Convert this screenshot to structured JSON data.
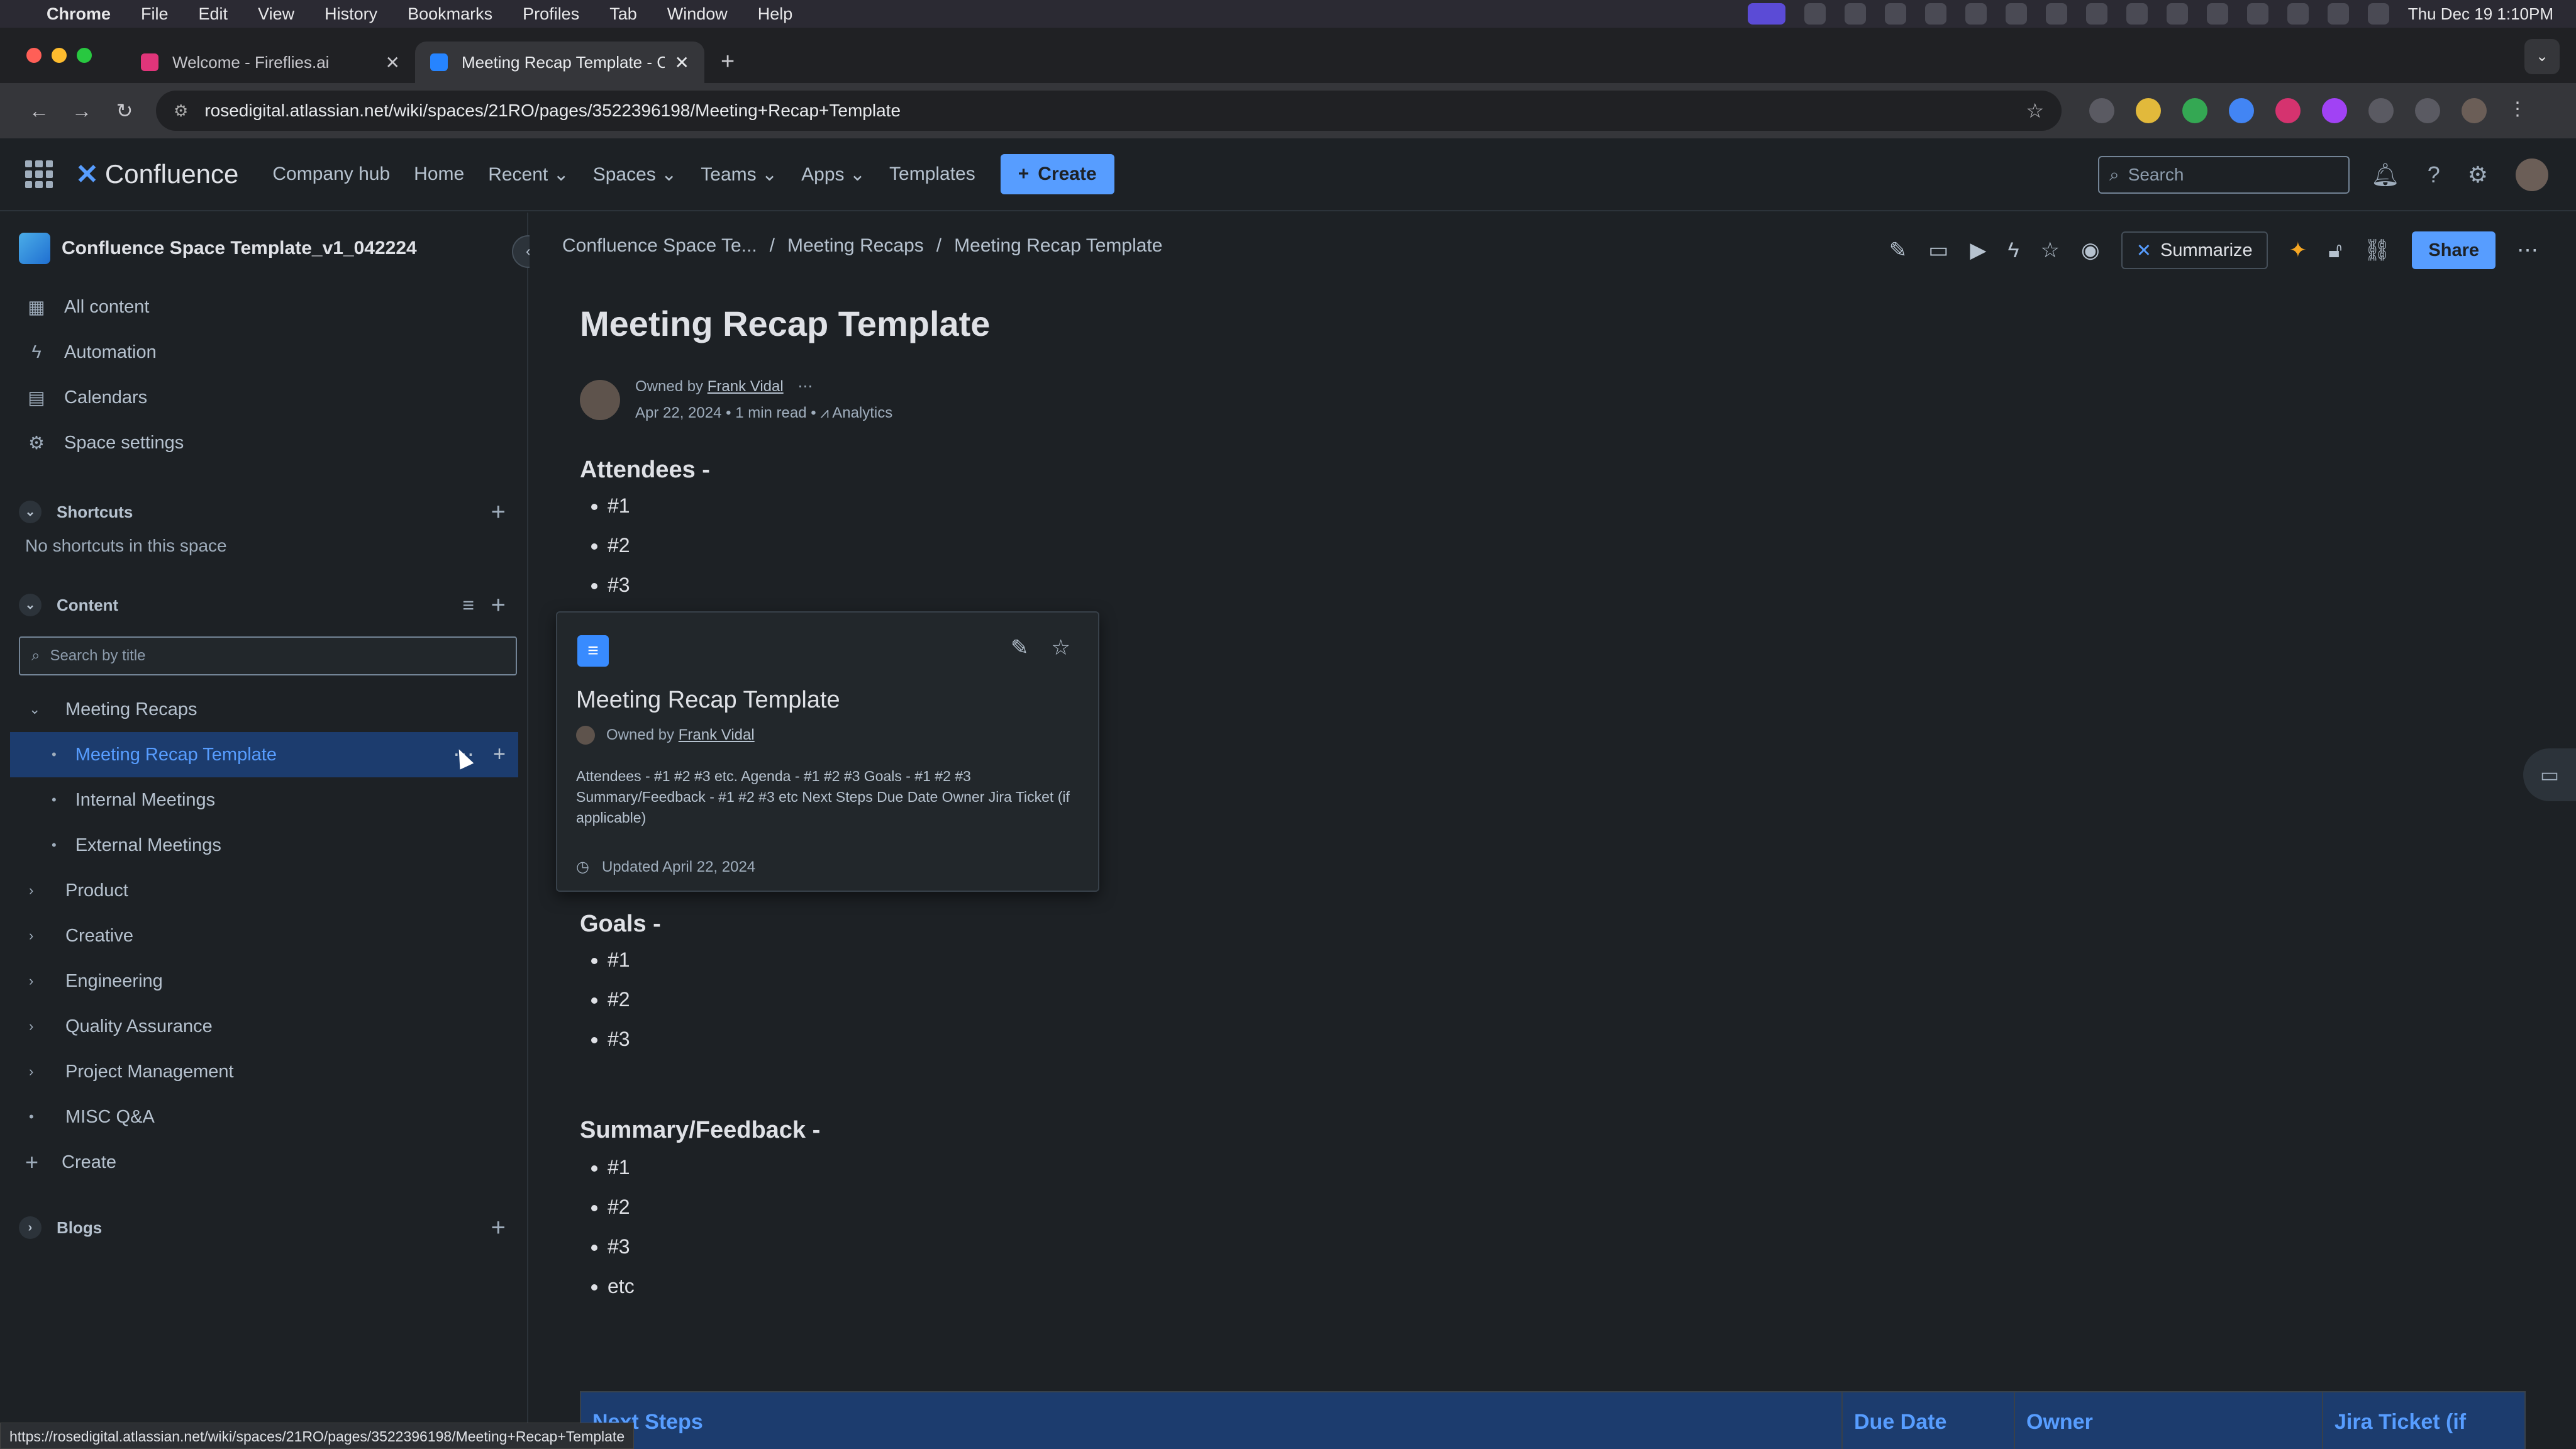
{
  "os_menubar": {
    "app": "Chrome",
    "items": [
      "File",
      "Edit",
      "View",
      "History",
      "Bookmarks",
      "Profiles",
      "Tab",
      "Window",
      "Help"
    ],
    "clock": "Thu Dec 19  1:10PM"
  },
  "browser": {
    "tabs": [
      {
        "label": "Welcome - Fireflies.ai",
        "active": false
      },
      {
        "label": "Meeting Recap Template - Co",
        "active": true
      }
    ],
    "url": "rosedigital.atlassian.net/wiki/spaces/21RO/pages/3522396198/Meeting+Recap+Template",
    "status_url": "https://rosedigital.atlassian.net/wiki/spaces/21RO/pages/3522396198/Meeting+Recap+Template"
  },
  "header": {
    "logo": "Confluence",
    "nav": [
      "Company hub",
      "Home",
      "Recent",
      "Spaces",
      "Teams",
      "Apps",
      "Templates"
    ],
    "create_label": "Create",
    "search_placeholder": "Search"
  },
  "sidebar": {
    "space_name": "Confluence Space Template_v1_042224",
    "nav": [
      {
        "icon": "grid-icon",
        "label": "All content"
      },
      {
        "icon": "bolt-icon",
        "label": "Automation"
      },
      {
        "icon": "calendar-icon",
        "label": "Calendars"
      },
      {
        "icon": "gear-icon",
        "label": "Space settings"
      }
    ],
    "shortcuts_title": "Shortcuts",
    "shortcuts_empty": "No shortcuts in this space",
    "content_title": "Content",
    "search_placeholder": "Search by title",
    "tree": [
      {
        "label": "Meeting Recaps",
        "level": 0,
        "expanded": true
      },
      {
        "label": "Meeting Recap Template",
        "level": 1,
        "active": true
      },
      {
        "label": "Internal Meetings",
        "level": 1
      },
      {
        "label": "External Meetings",
        "level": 1
      },
      {
        "label": "Product",
        "level": 0
      },
      {
        "label": "Creative",
        "level": 0
      },
      {
        "label": "Engineering",
        "level": 0
      },
      {
        "label": "Quality Assurance",
        "level": 0
      },
      {
        "label": "Project Management",
        "level": 0
      },
      {
        "label": "MISC Q&A",
        "level": 0
      }
    ],
    "create_label": "Create",
    "blogs_title": "Blogs"
  },
  "page": {
    "breadcrumb": [
      "Confluence Space Te...",
      "/",
      "Meeting Recaps",
      "/",
      "Meeting Recap Template"
    ],
    "summarize_label": "Summarize",
    "share_label": "Share",
    "title": "Meeting Recap Template",
    "owned_by": "Owned by",
    "owner": "Frank Vidal",
    "date": "Apr 22, 2024",
    "read_time": "1 min read",
    "analytics": "Analytics",
    "attendees_heading": "Attendees -",
    "attendees": [
      "#1",
      "#2",
      "#3"
    ],
    "goals_heading": "Goals -",
    "goals": [
      "#1",
      "#2",
      "#3"
    ],
    "summary_heading": "Summary/Feedback -",
    "summary": [
      "#1",
      "#2",
      "#3",
      "etc"
    ],
    "table_headers": [
      "Next Steps",
      "Due Date",
      "Owner",
      "Jira Ticket (if"
    ]
  },
  "hover_card": {
    "title": "Meeting Recap Template",
    "owned_by": "Owned by",
    "owner": "Frank Vidal",
    "excerpt": "Attendees - #1 #2 #3 etc. Agenda - #1 #2 #3 Goals - #1 #2 #3 Summary/Feedback - #1 #2 #3 etc Next Steps Due Date Owner Jira Ticket (if applicable)",
    "updated": "Updated April 22, 2024"
  }
}
